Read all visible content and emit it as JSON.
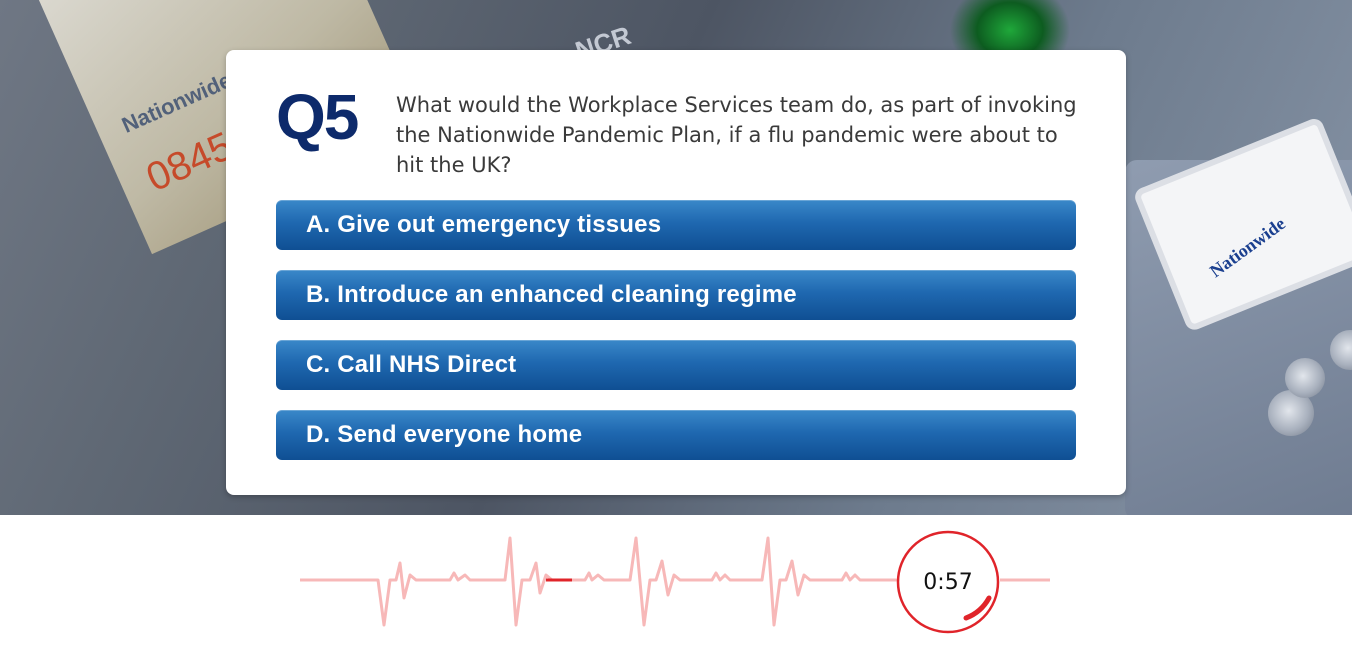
{
  "question": {
    "number": "Q5",
    "text": "What would the Workplace Services team do, as part of invoking the Nationwide Pandemic Plan, if a flu pandemic were about to hit the UK?"
  },
  "answers": [
    {
      "label": "A. Give out emergency tissues"
    },
    {
      "label": "B. Introduce an enhanced cleaning regime"
    },
    {
      "label": "C. Call NHS Direct"
    },
    {
      "label": "D. Send everyone home"
    }
  ],
  "timer": {
    "display": "0:57",
    "ring_color": "#e0242a",
    "ecg_color": "#f7b8b8",
    "ecg_progress_color": "#e0242a"
  },
  "background": {
    "atm_brand_text": "NCR",
    "slot_label": "Nationwide",
    "slot_number": "0845",
    "card_brand": "Nationwide"
  },
  "colors": {
    "question_number": "#0d2a6b",
    "button_top": "#3a88c9",
    "button_bottom": "#0f4f93"
  }
}
